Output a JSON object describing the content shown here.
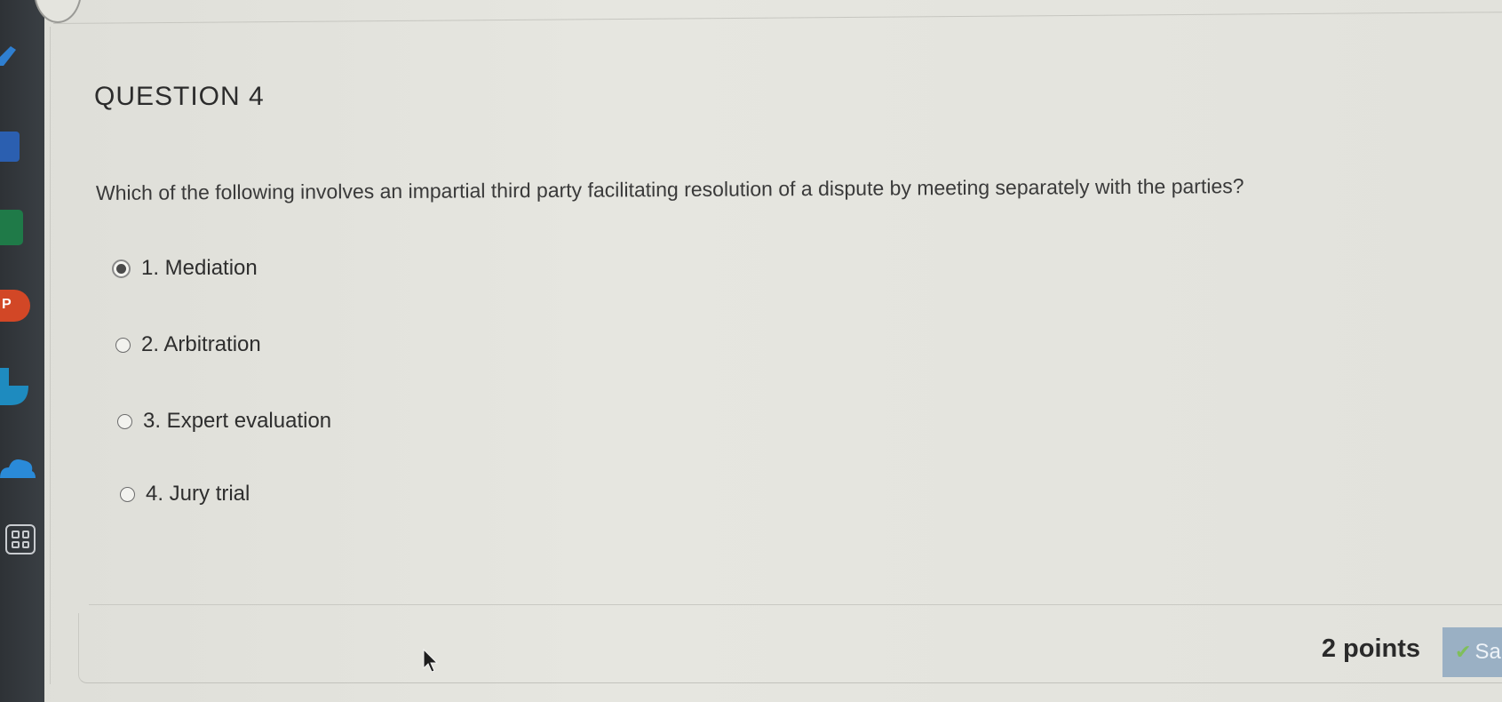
{
  "question": {
    "title": "QUESTION 4",
    "text": "Which of the following involves an impartial third party facilitating resolution of a dispute by meeting separately with the parties?",
    "options": [
      {
        "label": "1. Mediation",
        "selected": true
      },
      {
        "label": "2. Arbitration",
        "selected": false
      },
      {
        "label": "3. Expert evaluation",
        "selected": false
      },
      {
        "label": "4. Jury trial",
        "selected": false
      }
    ]
  },
  "footer": {
    "points": "2 points",
    "save_label": "Sa"
  },
  "taskbar": {
    "icons": [
      "pen-icon",
      "word-icon",
      "excel-icon",
      "powerpoint-icon",
      "sway-icon",
      "onedrive-icon",
      "app-launcher-icon"
    ]
  },
  "colors": {
    "background": "#e2e2dc",
    "save_button": "#9ab0c4",
    "check": "#7fbf5a"
  }
}
